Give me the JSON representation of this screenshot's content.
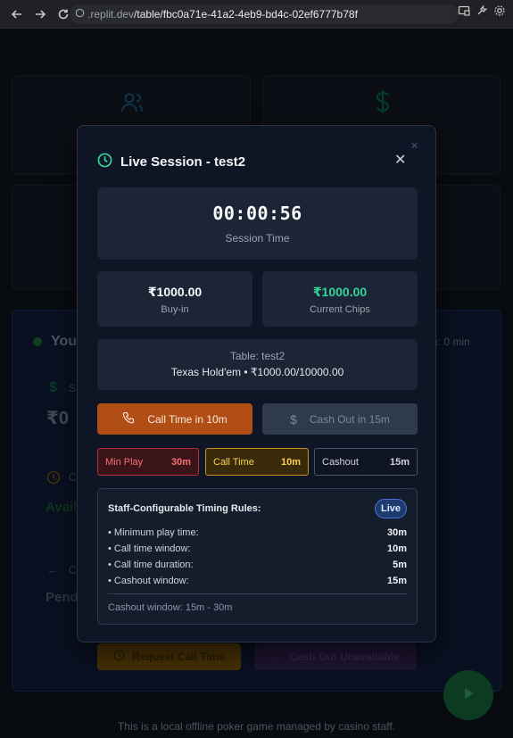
{
  "browser": {
    "url_prefix": "replit.dev",
    "url_path": "/table/fbc0a71e-41a2-4eb9-bd4c-02ef6777b78f"
  },
  "background": {
    "panel_title": "You",
    "session_label": "n: 0 min",
    "stat_label_s": "S",
    "amount": "₹0",
    "clock_label_c": "C",
    "avail_text": "Avail",
    "pending_label_c": "C",
    "pending_text": "Pend",
    "request_call_time": "Request Call Time",
    "cash_out_unavailable": "Cash Out Unavailable",
    "footer_text": "This is a local offline poker game managed by casino staff."
  },
  "modal": {
    "title": "Live Session - test2",
    "timer": {
      "value": "00:00:56",
      "label": "Session Time"
    },
    "buy_in": {
      "value": "₹1000.00",
      "label": "Buy-in"
    },
    "chips": {
      "value": "₹1000.00",
      "label": "Current Chips"
    },
    "table": {
      "line1": "Table: test2",
      "line2": "Texas Hold'em • ₹1000.00/10000.00"
    },
    "actions": {
      "call_time": "Call Time in 10m",
      "cash_out": "Cash Out in 15m"
    },
    "pills": {
      "min_play": {
        "label": "Min Play",
        "value": "30m"
      },
      "call_time": {
        "label": "Call Time",
        "value": "10m"
      },
      "cashout": {
        "label": "Cashout",
        "value": "15m"
      }
    },
    "rules": {
      "title": "Staff-Configurable Timing Rules:",
      "badge": "Live",
      "items": [
        {
          "label": "• Minimum play time:",
          "value": "30m"
        },
        {
          "label": "• Call time window:",
          "value": "10m"
        },
        {
          "label": "• Call time duration:",
          "value": "5m"
        },
        {
          "label": "• Cashout window:",
          "value": "15m"
        }
      ],
      "note": "Cashout window: 15m - 30m"
    }
  },
  "colors": {
    "accent_orange": "#b14e16",
    "accent_green": "#34d399",
    "badge_blue": "#1e3a6e"
  }
}
